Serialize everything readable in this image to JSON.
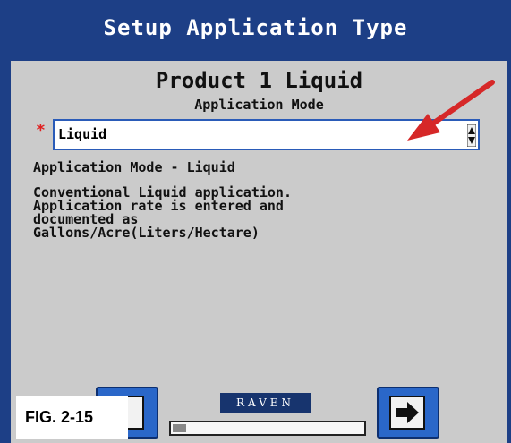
{
  "window": {
    "title": "Setup Application Type"
  },
  "product": {
    "title": "Product 1 Liquid",
    "subtitle": "Application Mode"
  },
  "mode_select": {
    "required_marker": "*",
    "value": "Liquid"
  },
  "mode_heading": "Application Mode - Liquid",
  "description_lines": [
    "Conventional Liquid application.",
    "Application rate is entered and",
    "documented as",
    "Gallons/Acre(Liters/Hectare)"
  ],
  "figure_label": "FIG. 2-15",
  "logo_text": "RAVEN",
  "progress": {
    "fraction": 0.07
  },
  "icons": {
    "back": "page-back-icon",
    "next": "page-next-arrow-icon",
    "spinner": "up-down-spinner-icon",
    "pointer": "red-arrow-icon"
  },
  "colors": {
    "frame": "#1d3f86",
    "panel": "#cbcbcb",
    "button": "#2a67c9",
    "required": "#e02020",
    "pointer_arrow": "#d62828"
  }
}
